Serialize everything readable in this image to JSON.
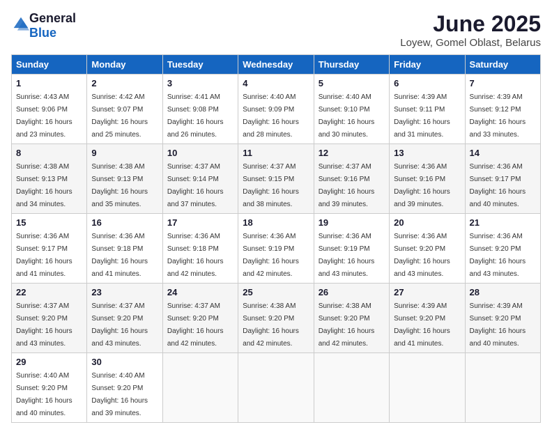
{
  "header": {
    "logo": {
      "general": "General",
      "blue": "Blue"
    },
    "title": "June 2025",
    "location": "Loyew, Gomel Oblast, Belarus"
  },
  "calendar": {
    "days_of_week": [
      "Sunday",
      "Monday",
      "Tuesday",
      "Wednesday",
      "Thursday",
      "Friday",
      "Saturday"
    ],
    "weeks": [
      [
        null,
        {
          "day": "2",
          "sunrise": "4:42 AM",
          "sunset": "9:07 PM",
          "daylight": "16 hours and 25 minutes."
        },
        {
          "day": "3",
          "sunrise": "4:41 AM",
          "sunset": "9:08 PM",
          "daylight": "16 hours and 26 minutes."
        },
        {
          "day": "4",
          "sunrise": "4:40 AM",
          "sunset": "9:09 PM",
          "daylight": "16 hours and 28 minutes."
        },
        {
          "day": "5",
          "sunrise": "4:40 AM",
          "sunset": "9:10 PM",
          "daylight": "16 hours and 30 minutes."
        },
        {
          "day": "6",
          "sunrise": "4:39 AM",
          "sunset": "9:11 PM",
          "daylight": "16 hours and 31 minutes."
        },
        {
          "day": "7",
          "sunrise": "4:39 AM",
          "sunset": "9:12 PM",
          "daylight": "16 hours and 33 minutes."
        }
      ],
      [
        {
          "day": "1",
          "sunrise": "4:43 AM",
          "sunset": "9:06 PM",
          "daylight": "16 hours and 23 minutes."
        },
        null,
        null,
        null,
        null,
        null,
        null
      ],
      [
        {
          "day": "8",
          "sunrise": "4:38 AM",
          "sunset": "9:13 PM",
          "daylight": "16 hours and 34 minutes."
        },
        {
          "day": "9",
          "sunrise": "4:38 AM",
          "sunset": "9:13 PM",
          "daylight": "16 hours and 35 minutes."
        },
        {
          "day": "10",
          "sunrise": "4:37 AM",
          "sunset": "9:14 PM",
          "daylight": "16 hours and 37 minutes."
        },
        {
          "day": "11",
          "sunrise": "4:37 AM",
          "sunset": "9:15 PM",
          "daylight": "16 hours and 38 minutes."
        },
        {
          "day": "12",
          "sunrise": "4:37 AM",
          "sunset": "9:16 PM",
          "daylight": "16 hours and 39 minutes."
        },
        {
          "day": "13",
          "sunrise": "4:36 AM",
          "sunset": "9:16 PM",
          "daylight": "16 hours and 39 minutes."
        },
        {
          "day": "14",
          "sunrise": "4:36 AM",
          "sunset": "9:17 PM",
          "daylight": "16 hours and 40 minutes."
        }
      ],
      [
        {
          "day": "15",
          "sunrise": "4:36 AM",
          "sunset": "9:17 PM",
          "daylight": "16 hours and 41 minutes."
        },
        {
          "day": "16",
          "sunrise": "4:36 AM",
          "sunset": "9:18 PM",
          "daylight": "16 hours and 41 minutes."
        },
        {
          "day": "17",
          "sunrise": "4:36 AM",
          "sunset": "9:18 PM",
          "daylight": "16 hours and 42 minutes."
        },
        {
          "day": "18",
          "sunrise": "4:36 AM",
          "sunset": "9:19 PM",
          "daylight": "16 hours and 42 minutes."
        },
        {
          "day": "19",
          "sunrise": "4:36 AM",
          "sunset": "9:19 PM",
          "daylight": "16 hours and 43 minutes."
        },
        {
          "day": "20",
          "sunrise": "4:36 AM",
          "sunset": "9:20 PM",
          "daylight": "16 hours and 43 minutes."
        },
        {
          "day": "21",
          "sunrise": "4:36 AM",
          "sunset": "9:20 PM",
          "daylight": "16 hours and 43 minutes."
        }
      ],
      [
        {
          "day": "22",
          "sunrise": "4:37 AM",
          "sunset": "9:20 PM",
          "daylight": "16 hours and 43 minutes."
        },
        {
          "day": "23",
          "sunrise": "4:37 AM",
          "sunset": "9:20 PM",
          "daylight": "16 hours and 43 minutes."
        },
        {
          "day": "24",
          "sunrise": "4:37 AM",
          "sunset": "9:20 PM",
          "daylight": "16 hours and 42 minutes."
        },
        {
          "day": "25",
          "sunrise": "4:38 AM",
          "sunset": "9:20 PM",
          "daylight": "16 hours and 42 minutes."
        },
        {
          "day": "26",
          "sunrise": "4:38 AM",
          "sunset": "9:20 PM",
          "daylight": "16 hours and 42 minutes."
        },
        {
          "day": "27",
          "sunrise": "4:39 AM",
          "sunset": "9:20 PM",
          "daylight": "16 hours and 41 minutes."
        },
        {
          "day": "28",
          "sunrise": "4:39 AM",
          "sunset": "9:20 PM",
          "daylight": "16 hours and 40 minutes."
        }
      ],
      [
        {
          "day": "29",
          "sunrise": "4:40 AM",
          "sunset": "9:20 PM",
          "daylight": "16 hours and 40 minutes."
        },
        {
          "day": "30",
          "sunrise": "4:40 AM",
          "sunset": "9:20 PM",
          "daylight": "16 hours and 39 minutes."
        },
        null,
        null,
        null,
        null,
        null
      ]
    ]
  }
}
